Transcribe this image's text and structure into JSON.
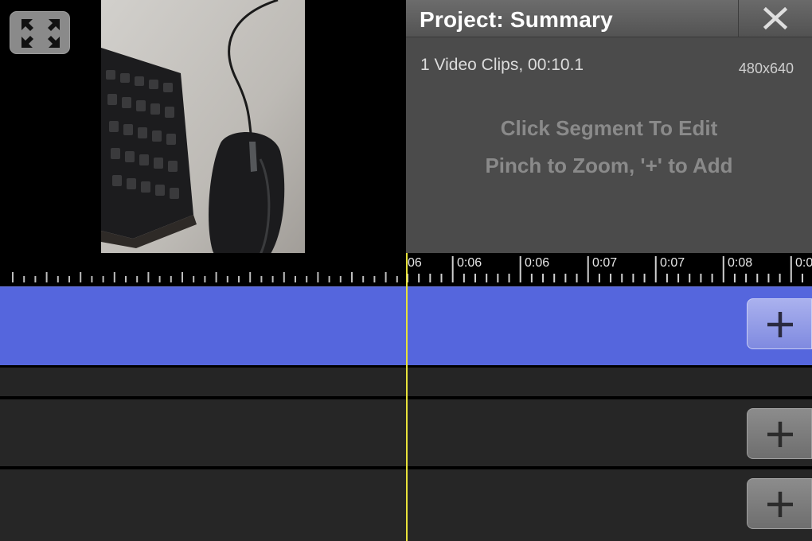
{
  "preview": {
    "fullscreen_icon": "expand-arrows-icon"
  },
  "summary": {
    "title": "Project: Summary",
    "close_icon": "close-x-icon",
    "clips_info": "1 Video Clips, 00:10.1",
    "resolution": "480x640",
    "hint_line_1": "Click Segment To Edit",
    "hint_line_2": "Pinch to Zoom, '+' to Add"
  },
  "timeline": {
    "tick_labels": [
      "06",
      "0:06",
      "0:06",
      "0:07",
      "0:07",
      "0:08",
      "0:0"
    ],
    "video_track_color": "#5566dd",
    "playhead_color": "#e8e23a",
    "add_button_icon": "plus-icon"
  }
}
